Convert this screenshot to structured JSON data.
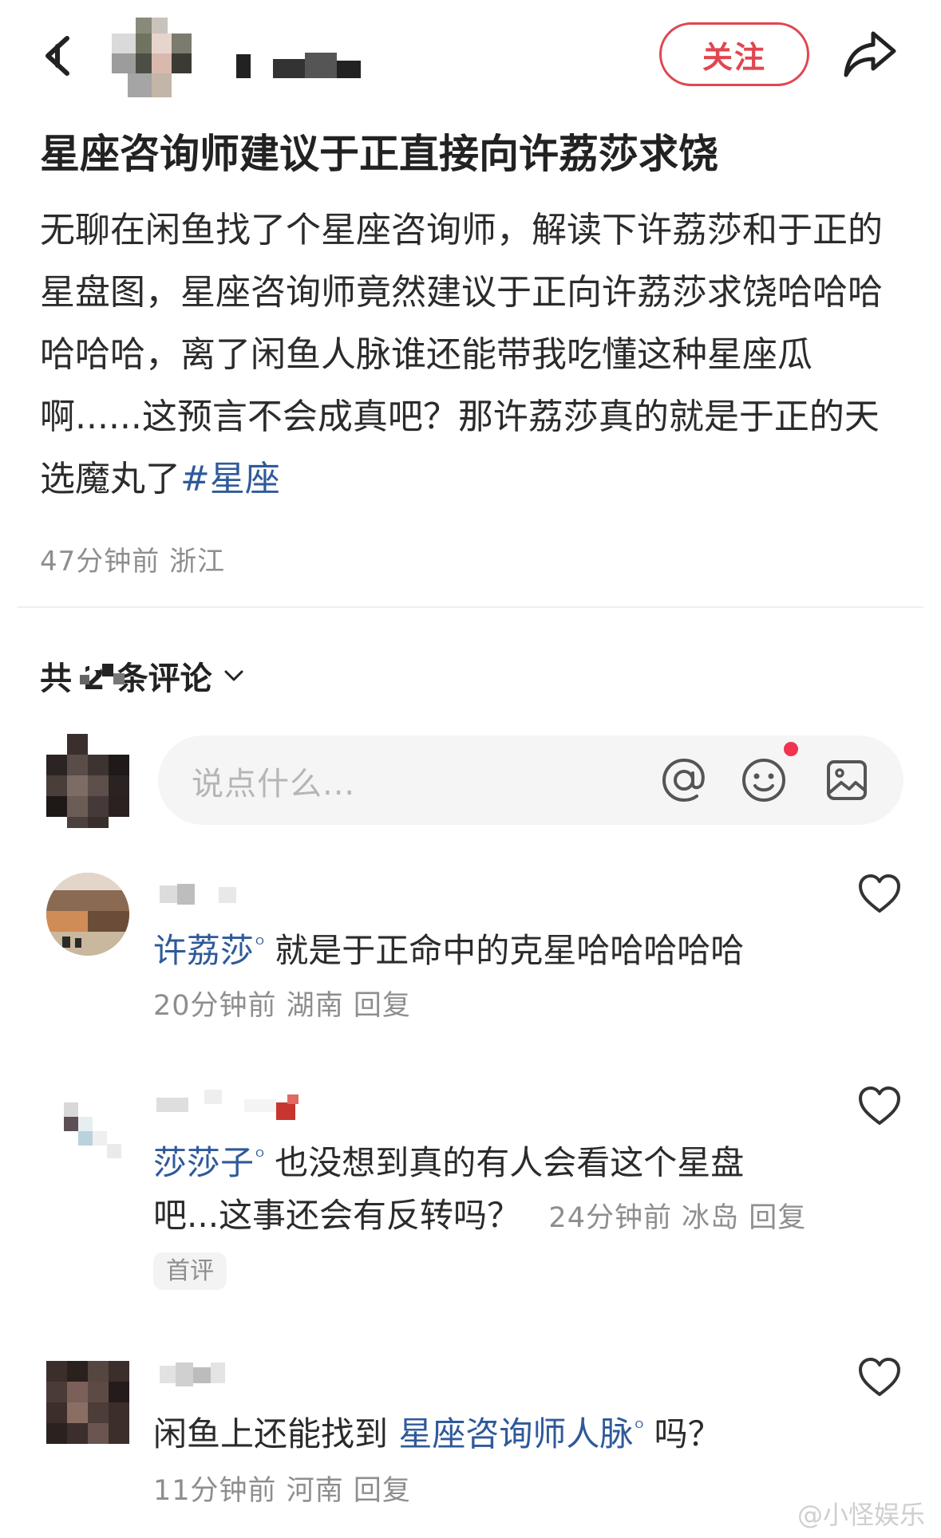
{
  "header": {
    "follow_label": "关注"
  },
  "post": {
    "title": "星座咨询师建议于正直接向许荔莎求饶",
    "body": "无聊在闲鱼找了个星座咨询师，解读下许荔莎和于正的星盘图，星座咨询师竟然建议于正向许荔莎求饶哈哈哈哈哈哈，离了闲鱼人脉谁还能带我吃懂这种星座瓜啊......这预言不会成真吧？那许荔莎真的就是于正的天选魔丸了",
    "hashtag": "#星座",
    "time": "47分钟前",
    "location": "浙江"
  },
  "comments_header": {
    "label": "共 2 条评论"
  },
  "input": {
    "placeholder": "说点什么..."
  },
  "comments": [
    {
      "mention": "许荔莎",
      "text": "就是于正命中的克星哈哈哈哈哈",
      "time": "20分钟前",
      "location": "湖南",
      "reply": "回复"
    },
    {
      "mention": "莎莎子",
      "text_line1": "也没想到真的有人会看这个星盘",
      "text_line2": "吧...这事还会有反转吗？",
      "time": "24分钟前",
      "location": "冰岛",
      "reply": "回复",
      "badge": "首评"
    },
    {
      "text_before": "闲鱼上还能找到",
      "mention": "星座咨询师人脉",
      "text_after": "吗？",
      "time": "11分钟前",
      "location": "河南",
      "reply": "回复"
    }
  ],
  "watermark": "@小怪娱乐",
  "colors": {
    "accent_red": "#e1464f",
    "link_blue": "#2f5a9a",
    "meta_gray": "#8e8e8e",
    "notification_dot": "#f0334f"
  },
  "icons": [
    "back-arrow-icon",
    "share-icon",
    "at-icon",
    "emoji-icon",
    "image-icon",
    "heart-icon",
    "chevron-down-icon",
    "search-mini-icon"
  ]
}
